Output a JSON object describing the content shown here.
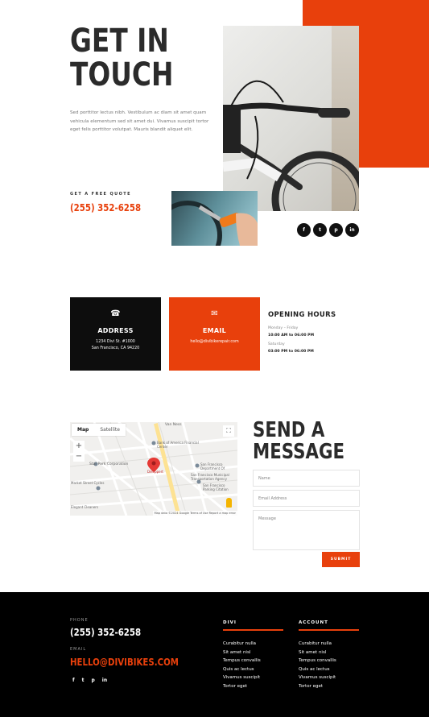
{
  "hero": {
    "title_line1": "GET IN",
    "title_line2": "TOUCH",
    "description": "Sed porttitor lectus nibh. Vestibulum ac diam sit amet quam vehicula elementum sed sit amet dui. Vivamus suscipit tortor eget felis porttitor volutpat. Mauris blandit aliquet elit.",
    "quote_label": "GET A FREE QUOTE",
    "quote_phone": "(255) 352-6258",
    "social": [
      "f",
      "t",
      "p",
      "in"
    ]
  },
  "cards": {
    "address": {
      "icon": "☎",
      "title": "ADDRESS",
      "line1": "1234 Divi St. #1000",
      "line2": "San Francisco, CA 94220"
    },
    "email": {
      "icon": "✉",
      "title": "EMAIL",
      "line1": "hello@divibikerepair.com"
    }
  },
  "hours": {
    "title": "OPENING HOURS",
    "day1": "Monday – Friday",
    "time1": "10:00 AM to 06:00 PM",
    "day2": "Saturday",
    "time2": "03:00 PM to 06:00 PM"
  },
  "map": {
    "tab_map": "Map",
    "tab_satellite": "Satellite",
    "zoom_in": "+",
    "zoom_out": "−",
    "labels": [
      "Van Ness",
      "Bank of America Financial Center",
      "Star Park Corporation",
      "Market Street Cycles",
      "Elegant Cleaners",
      "Deloppert",
      "San Francisco Department Of",
      "San Francisco Municipal Transportation Agency",
      "San Francisco Parking Citation"
    ],
    "footer": "Map data ©2024 Google   Terms of Use   Report a map error"
  },
  "form": {
    "title_line1": "SEND A",
    "title_line2": "MESSAGE",
    "name_placeholder": "Name",
    "email_placeholder": "Email Address",
    "message_placeholder": "Message",
    "submit_label": "SUBMIT"
  },
  "footer": {
    "phone_label": "PHONE",
    "phone": "(255) 352-6258",
    "email_label": "EMAIL",
    "email": "HELLO@DIVIBIKES.COM",
    "social": [
      "f",
      "t",
      "p",
      "in"
    ],
    "col1_title": "DIVI",
    "col1_links": [
      "Curabitur nulla",
      "Sit amet nisl",
      "Tempus convallis",
      "Quis ac lectus",
      "Vivamus suscipit",
      "Tortor eget"
    ],
    "col2_title": "ACCOUNT",
    "col2_links": [
      "Curabitur nulla",
      "Sit amet nisl",
      "Tempus convallis",
      "Quis ac lectus",
      "Vivamus suscipit",
      "Tortor eget"
    ]
  },
  "colors": {
    "accent": "#e8400c",
    "dark": "#0d0d0d"
  }
}
